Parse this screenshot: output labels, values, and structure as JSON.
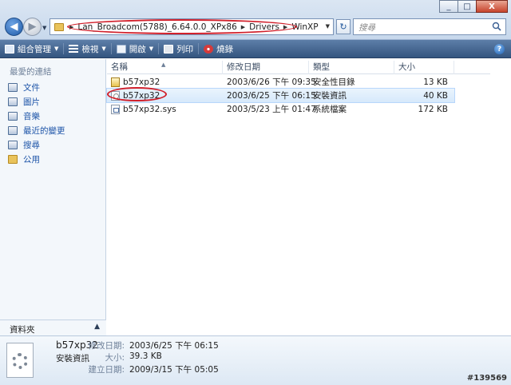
{
  "window": {
    "min": "_",
    "max": "□",
    "close": "X"
  },
  "nav": {
    "back": "◀",
    "forward": "▶",
    "dropdown": "▼"
  },
  "address": {
    "crumbs": [
      "Lan_Broadcom(5788)_6.64.0.0_XPx86",
      "Drivers",
      "WinXP"
    ],
    "dropdown": "▼",
    "refresh": "↻"
  },
  "search": {
    "placeholder": "搜尋"
  },
  "toolbar": {
    "organize": "組合管理",
    "views": "檢視",
    "open": "開啟",
    "print": "列印",
    "burn": "燒錄",
    "help": "?"
  },
  "sidebar": {
    "heading": "最愛的連結",
    "items": [
      {
        "label": "文件",
        "icon": "document-icon"
      },
      {
        "label": "圖片",
        "icon": "pictures-icon"
      },
      {
        "label": "音樂",
        "icon": "music-icon"
      },
      {
        "label": "最近的變更",
        "icon": "recent-icon"
      },
      {
        "label": "搜尋",
        "icon": "search-icon"
      },
      {
        "label": "公用",
        "icon": "public-folder-icon"
      }
    ],
    "folders_label": "資料夾",
    "folders_caret": "▲"
  },
  "filelist": {
    "columns": {
      "name": "名稱",
      "date": "修改日期",
      "type": "類型",
      "size": "大小",
      "sort": "▲"
    },
    "rows": [
      {
        "name": "b57xp32",
        "date": "2003/6/26 下午 09:35",
        "type": "安全性目錄",
        "size": "13 KB",
        "icon": "security-catalog-icon"
      },
      {
        "name": "b57xp32",
        "date": "2003/6/25 下午 06:15",
        "type": "安裝資訊",
        "size": "40 KB",
        "icon": "setup-information-icon"
      },
      {
        "name": "b57xp32.sys",
        "date": "2003/5/23 上午 01:47",
        "type": "系統檔案",
        "size": "172 KB",
        "icon": "system-file-icon"
      }
    ]
  },
  "details": {
    "name": "b57xp32",
    "type": "安裝資訊",
    "modified_label": "修改日期:",
    "modified_value": "2003/6/25 下午 06:15",
    "size_label": "大小:",
    "size_value": "39.3 KB",
    "created_label": "建立日期:",
    "created_value": "2009/3/15 下午 05:05"
  },
  "watermark": "#139569",
  "colors": {
    "annotation_red": "#d1202b",
    "toolbar": "#4a6b96",
    "link_blue": "#1d54a8"
  }
}
